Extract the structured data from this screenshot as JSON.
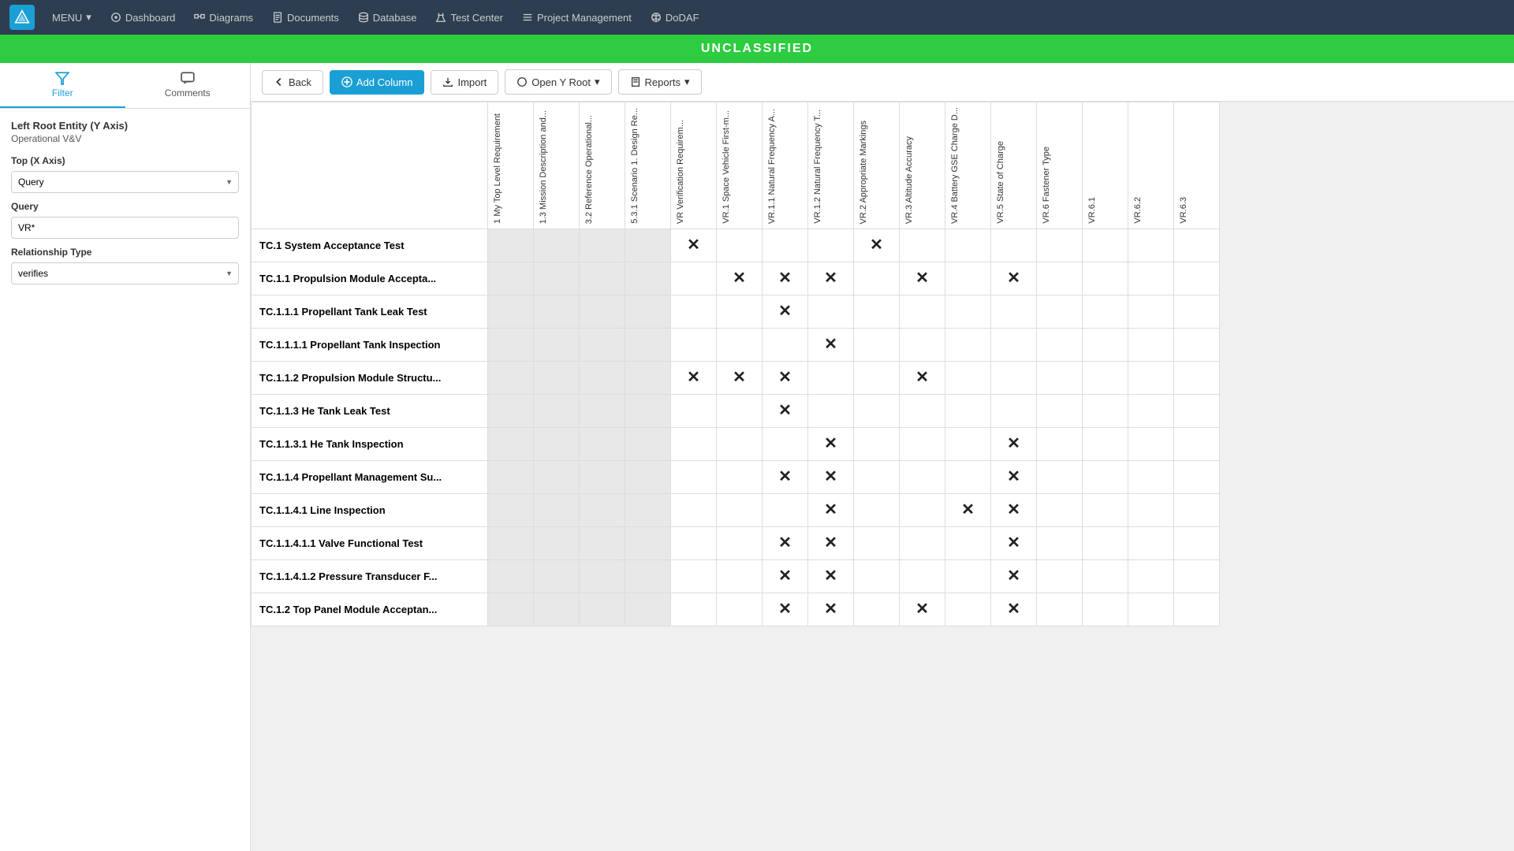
{
  "nav": {
    "logo_alt": "App Logo",
    "items": [
      {
        "id": "menu",
        "label": "MENU",
        "has_dropdown": true
      },
      {
        "id": "dashboard",
        "label": "Dashboard"
      },
      {
        "id": "diagrams",
        "label": "Diagrams"
      },
      {
        "id": "documents",
        "label": "Documents"
      },
      {
        "id": "database",
        "label": "Database"
      },
      {
        "id": "test_center",
        "label": "Test Center"
      },
      {
        "id": "project_management",
        "label": "Project Management"
      },
      {
        "id": "dodaf",
        "label": "DoDAF"
      }
    ]
  },
  "banner": {
    "text": "UNCLASSIFIED"
  },
  "sidebar": {
    "tabs": [
      {
        "id": "filter",
        "label": "Filter"
      },
      {
        "id": "comments",
        "label": "Comments"
      }
    ],
    "active_tab": "filter",
    "left_root_entity": {
      "label": "Left Root Entity (Y Axis)",
      "value": "Operational V&V"
    },
    "top_x_axis": {
      "label": "Top (X Axis)",
      "select_value": "Query",
      "options": [
        "Query"
      ]
    },
    "query": {
      "label": "Query",
      "value": "VR*"
    },
    "relationship_type": {
      "label": "Relationship Type",
      "select_value": "verifies",
      "options": [
        "verifies"
      ]
    }
  },
  "toolbar": {
    "back_label": "Back",
    "add_column_label": "Add Column",
    "import_label": "Import",
    "open_y_root_label": "Open Y Root",
    "reports_label": "Reports"
  },
  "matrix": {
    "columns": [
      {
        "id": "col1",
        "label": "1 My Top Level Requirement"
      },
      {
        "id": "col2",
        "label": "1.3 Mission Description and..."
      },
      {
        "id": "col3",
        "label": "3.2 Reference Operational..."
      },
      {
        "id": "col4",
        "label": "5.3.1 Scenario 1. Design Re..."
      },
      {
        "id": "col5",
        "label": "VR Verification Requirem..."
      },
      {
        "id": "col6",
        "label": "VR.1 Space Vehicle First-m..."
      },
      {
        "id": "col7",
        "label": "VR.1.1 Natural Frequency A..."
      },
      {
        "id": "col8",
        "label": "VR.1.2 Natural Frequency T..."
      },
      {
        "id": "col9",
        "label": "VR.2 Appropriate Markings"
      },
      {
        "id": "col10",
        "label": "VR.3 Altitude Accuracy"
      },
      {
        "id": "col11",
        "label": "VR.4 Battery GSE Charge D..."
      },
      {
        "id": "col12",
        "label": "VR.5 State of Charge"
      },
      {
        "id": "col13",
        "label": "VR.6 Fastener Type"
      },
      {
        "id": "col14",
        "label": "VR.6.1"
      },
      {
        "id": "col15",
        "label": "VR.6.2"
      },
      {
        "id": "col16",
        "label": "VR.6.3"
      }
    ],
    "rows": [
      {
        "label": "TC.1 System Acceptance Test",
        "grey_cols": [
          0,
          1,
          2,
          3
        ],
        "marks": [
          4,
          8
        ]
      },
      {
        "label": "TC.1.1 Propulsion Module Accepta...",
        "grey_cols": [
          0,
          1,
          2,
          3
        ],
        "marks": [
          5,
          6,
          7,
          9,
          11
        ]
      },
      {
        "label": "TC.1.1.1 Propellant Tank Leak Test",
        "grey_cols": [
          0,
          1,
          2,
          3
        ],
        "marks": [
          6
        ]
      },
      {
        "label": "TC.1.1.1.1 Propellant Tank Inspection",
        "grey_cols": [
          0,
          1,
          2,
          3
        ],
        "marks": [
          7
        ]
      },
      {
        "label": "TC.1.1.2 Propulsion Module Structu...",
        "grey_cols": [
          0,
          1,
          2,
          3
        ],
        "marks": [
          4,
          5,
          6,
          9
        ]
      },
      {
        "label": "TC.1.1.3 He Tank Leak Test",
        "grey_cols": [
          0,
          1,
          2,
          3
        ],
        "marks": [
          6
        ]
      },
      {
        "label": "TC.1.1.3.1 He Tank Inspection",
        "grey_cols": [
          0,
          1,
          2,
          3
        ],
        "marks": [
          7,
          11
        ]
      },
      {
        "label": "TC.1.1.4 Propellant Management Su...",
        "grey_cols": [
          0,
          1,
          2,
          3
        ],
        "marks": [
          6,
          7,
          11
        ]
      },
      {
        "label": "TC.1.1.4.1 Line Inspection",
        "grey_cols": [
          0,
          1,
          2,
          3
        ],
        "marks": [
          7,
          10,
          11
        ]
      },
      {
        "label": "TC.1.1.4.1.1 Valve Functional Test",
        "grey_cols": [
          0,
          1,
          2,
          3
        ],
        "marks": [
          6,
          7,
          11
        ]
      },
      {
        "label": "TC.1.1.4.1.2 Pressure Transducer F...",
        "grey_cols": [
          0,
          1,
          2,
          3
        ],
        "marks": [
          6,
          7,
          11
        ]
      },
      {
        "label": "TC.1.2 Top Panel Module Acceptan...",
        "grey_cols": [
          0,
          1,
          2,
          3
        ],
        "marks": [
          6,
          7,
          9,
          11
        ]
      }
    ]
  }
}
